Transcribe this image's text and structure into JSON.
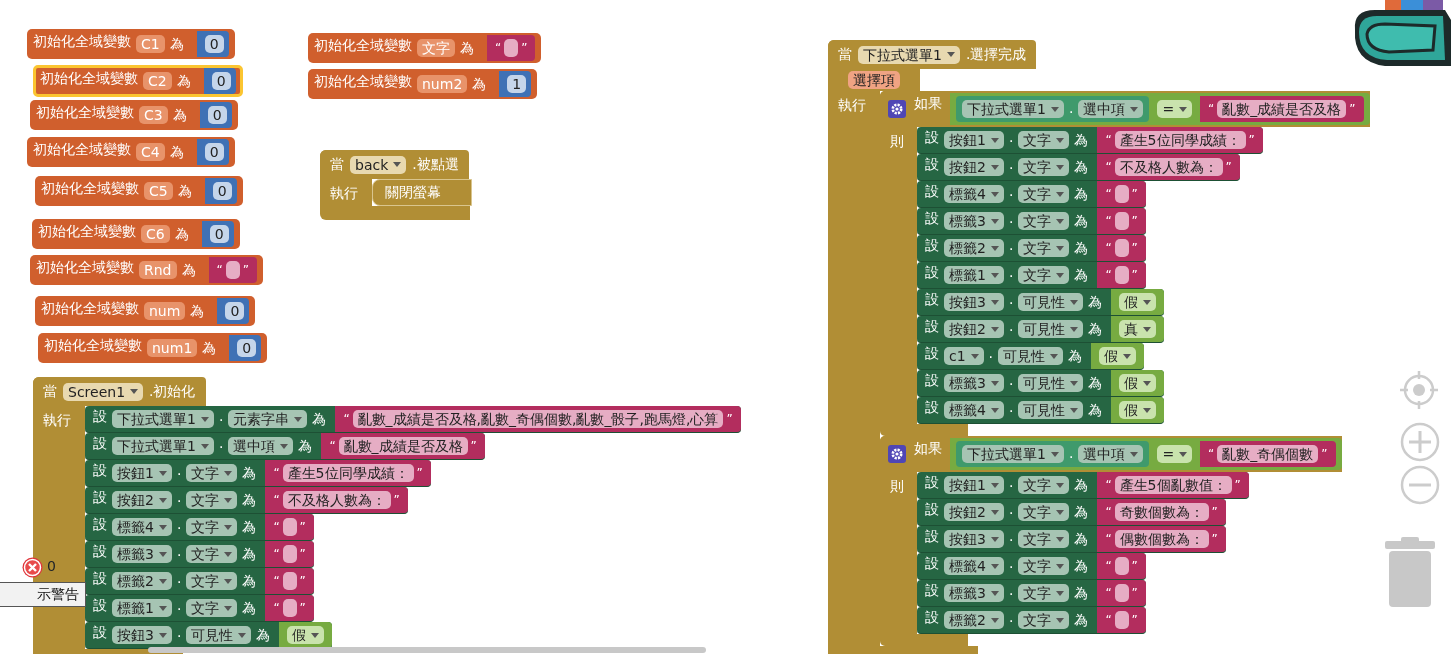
{
  "workspace": {
    "globals": [
      {
        "label": "初始化全域變數",
        "name": "C1",
        "to": "為",
        "value": {
          "kind": "number",
          "text": "0"
        },
        "selected": false
      },
      {
        "label": "初始化全域變數",
        "name": "C2",
        "to": "為",
        "value": {
          "kind": "number",
          "text": "0"
        },
        "selected": true
      },
      {
        "label": "初始化全域變數",
        "name": "C3",
        "to": "為",
        "value": {
          "kind": "number",
          "text": "0"
        },
        "selected": false
      },
      {
        "label": "初始化全域變數",
        "name": "C4",
        "to": "為",
        "value": {
          "kind": "number",
          "text": "0"
        },
        "selected": false
      },
      {
        "label": "初始化全域變數",
        "name": "C5",
        "to": "為",
        "value": {
          "kind": "number",
          "text": "0"
        },
        "selected": false
      },
      {
        "label": "初始化全域變數",
        "name": "C6",
        "to": "為",
        "value": {
          "kind": "number",
          "text": "0"
        },
        "selected": false
      },
      {
        "label": "初始化全域變數",
        "name": "Rnd",
        "to": "為",
        "value": {
          "kind": "text",
          "open": "“",
          "close": "”"
        },
        "selected": false
      },
      {
        "label": "初始化全域變數",
        "name": "num",
        "to": "為",
        "value": {
          "kind": "number",
          "text": "0"
        },
        "selected": false
      },
      {
        "label": "初始化全域變數",
        "name": "num1",
        "to": "為",
        "value": {
          "kind": "number",
          "text": "0"
        },
        "selected": false
      },
      {
        "label": "初始化全域變數",
        "name": "文字",
        "to": "為",
        "value": {
          "kind": "text",
          "open": "“",
          "close": "”"
        },
        "selected": false
      },
      {
        "label": "初始化全域變數",
        "name": "num2",
        "to": "為",
        "value": {
          "kind": "number",
          "text": "1"
        },
        "selected": false
      }
    ],
    "events": [
      {
        "keyword": "當",
        "component": "back",
        "event": ".被點選",
        "do_label": "執行",
        "statements": [
          {
            "kind": "call",
            "text": "關閉螢幕"
          }
        ]
      },
      {
        "keyword": "當",
        "component": "Screen1",
        "event": ".初始化",
        "do_label": "執行",
        "statements": [
          {
            "kind": "set",
            "keyword": "設",
            "component": "下拉式選單1",
            "dot": ".",
            "property": "元素字串",
            "to": "為",
            "value": {
              "kind": "text",
              "open": "“",
              "close": "”",
              "text": "亂數_成績是否及格,亂數_奇偶個數,亂數_骰子,跑馬燈,心算"
            }
          },
          {
            "kind": "set",
            "keyword": "設",
            "component": "下拉式選單1",
            "dot": ".",
            "property": "選中項",
            "to": "為",
            "value": {
              "kind": "text",
              "open": "“",
              "close": "”",
              "text": "亂數_成績是否及格"
            }
          },
          {
            "kind": "set",
            "keyword": "設",
            "component": "按鈕1",
            "dot": ".",
            "property": "文字",
            "to": "為",
            "value": {
              "kind": "text",
              "open": "“",
              "close": "”",
              "text": "產生5位同學成績："
            }
          },
          {
            "kind": "set",
            "keyword": "設",
            "component": "按鈕2",
            "dot": ".",
            "property": "文字",
            "to": "為",
            "value": {
              "kind": "text",
              "open": "“",
              "close": "”",
              "text": "不及格人數為："
            }
          },
          {
            "kind": "set",
            "keyword": "設",
            "component": "標籤4",
            "dot": ".",
            "property": "文字",
            "to": "為",
            "value": {
              "kind": "text",
              "open": "“",
              "close": "”"
            }
          },
          {
            "kind": "set",
            "keyword": "設",
            "component": "標籤3",
            "dot": ".",
            "property": "文字",
            "to": "為",
            "value": {
              "kind": "text",
              "open": "“",
              "close": "”"
            }
          },
          {
            "kind": "set",
            "keyword": "設",
            "component": "標籤2",
            "dot": ".",
            "property": "文字",
            "to": "為",
            "value": {
              "kind": "text",
              "open": "“",
              "close": "”"
            }
          },
          {
            "kind": "set",
            "keyword": "設",
            "component": "標籤1",
            "dot": ".",
            "property": "文字",
            "to": "為",
            "value": {
              "kind": "text",
              "open": "“",
              "close": "”"
            }
          },
          {
            "kind": "set",
            "keyword": "設",
            "component": "按鈕3",
            "dot": ".",
            "property": "可見性",
            "to": "為",
            "value": {
              "kind": "boolean",
              "text": "假"
            }
          }
        ]
      },
      {
        "keyword": "當",
        "component": "下拉式選單1",
        "event": ".選擇完成",
        "param": "選擇項",
        "do_label": "執行",
        "statements": [
          {
            "kind": "if",
            "label": "如果",
            "then_label": "則",
            "condition": {
              "kind": "compare",
              "left": {
                "component": "下拉式選單1",
                "dot": ".",
                "property": "選中項"
              },
              "op": "=",
              "right": {
                "kind": "text",
                "open": "“",
                "close": "”",
                "text": "亂數_成績是否及格"
              }
            },
            "statements": [
              {
                "kind": "set",
                "keyword": "設",
                "component": "按鈕1",
                "dot": ".",
                "property": "文字",
                "to": "為",
                "value": {
                  "kind": "text",
                  "open": "“",
                  "close": "”",
                  "text": "產生5位同學成績："
                }
              },
              {
                "kind": "set",
                "keyword": "設",
                "component": "按鈕2",
                "dot": ".",
                "property": "文字",
                "to": "為",
                "value": {
                  "kind": "text",
                  "open": "“",
                  "close": "”",
                  "text": "不及格人數為："
                }
              },
              {
                "kind": "set",
                "keyword": "設",
                "component": "標籤4",
                "dot": ".",
                "property": "文字",
                "to": "為",
                "value": {
                  "kind": "text",
                  "open": "“",
                  "close": "”"
                }
              },
              {
                "kind": "set",
                "keyword": "設",
                "component": "標籤3",
                "dot": ".",
                "property": "文字",
                "to": "為",
                "value": {
                  "kind": "text",
                  "open": "“",
                  "close": "”"
                }
              },
              {
                "kind": "set",
                "keyword": "設",
                "component": "標籤2",
                "dot": ".",
                "property": "文字",
                "to": "為",
                "value": {
                  "kind": "text",
                  "open": "“",
                  "close": "”"
                }
              },
              {
                "kind": "set",
                "keyword": "設",
                "component": "標籤1",
                "dot": ".",
                "property": "文字",
                "to": "為",
                "value": {
                  "kind": "text",
                  "open": "“",
                  "close": "”"
                }
              },
              {
                "kind": "set",
                "keyword": "設",
                "component": "按鈕3",
                "dot": ".",
                "property": "可見性",
                "to": "為",
                "value": {
                  "kind": "boolean",
                  "text": "假"
                }
              },
              {
                "kind": "set",
                "keyword": "設",
                "component": "按鈕2",
                "dot": ".",
                "property": "可見性",
                "to": "為",
                "value": {
                  "kind": "boolean",
                  "text": "真"
                }
              },
              {
                "kind": "set",
                "keyword": "設",
                "component": "c1",
                "dot": ".",
                "property": "可見性",
                "to": "為",
                "value": {
                  "kind": "boolean",
                  "text": "假"
                }
              },
              {
                "kind": "set",
                "keyword": "設",
                "component": "標籤3",
                "dot": ".",
                "property": "可見性",
                "to": "為",
                "value": {
                  "kind": "boolean",
                  "text": "假"
                }
              },
              {
                "kind": "set",
                "keyword": "設",
                "component": "標籤4",
                "dot": ".",
                "property": "可見性",
                "to": "為",
                "value": {
                  "kind": "boolean",
                  "text": "假"
                }
              }
            ]
          },
          {
            "kind": "if",
            "label": "如果",
            "then_label": "則",
            "condition": {
              "kind": "compare",
              "left": {
                "component": "下拉式選單1",
                "dot": ".",
                "property": "選中項"
              },
              "op": "=",
              "right": {
                "kind": "text",
                "open": "“",
                "close": "”",
                "text": "亂數_奇偶個數"
              }
            },
            "statements": [
              {
                "kind": "set",
                "keyword": "設",
                "component": "按鈕1",
                "dot": ".",
                "property": "文字",
                "to": "為",
                "value": {
                  "kind": "text",
                  "open": "“",
                  "close": "”",
                  "text": "產生5個亂數值："
                }
              },
              {
                "kind": "set",
                "keyword": "設",
                "component": "按鈕2",
                "dot": ".",
                "property": "文字",
                "to": "為",
                "value": {
                  "kind": "text",
                  "open": "“",
                  "close": "”",
                  "text": "奇數個數為："
                }
              },
              {
                "kind": "set",
                "keyword": "設",
                "component": "按鈕3",
                "dot": ".",
                "property": "文字",
                "to": "為",
                "value": {
                  "kind": "text",
                  "open": "“",
                  "close": "”",
                  "text": "偶數個數為："
                }
              },
              {
                "kind": "set",
                "keyword": "設",
                "component": "標籤4",
                "dot": ".",
                "property": "文字",
                "to": "為",
                "value": {
                  "kind": "text",
                  "open": "“",
                  "close": "”"
                }
              },
              {
                "kind": "set",
                "keyword": "設",
                "component": "標籤3",
                "dot": ".",
                "property": "文字",
                "to": "為",
                "value": {
                  "kind": "text",
                  "open": "“",
                  "close": "”"
                }
              },
              {
                "kind": "set",
                "keyword": "設",
                "component": "標籤2",
                "dot": ".",
                "property": "文字",
                "to": "為",
                "value": {
                  "kind": "text",
                  "open": "“",
                  "close": "”"
                }
              }
            ]
          }
        ]
      }
    ]
  },
  "warnings": {
    "count": "0",
    "toggle_label": "示警告"
  }
}
